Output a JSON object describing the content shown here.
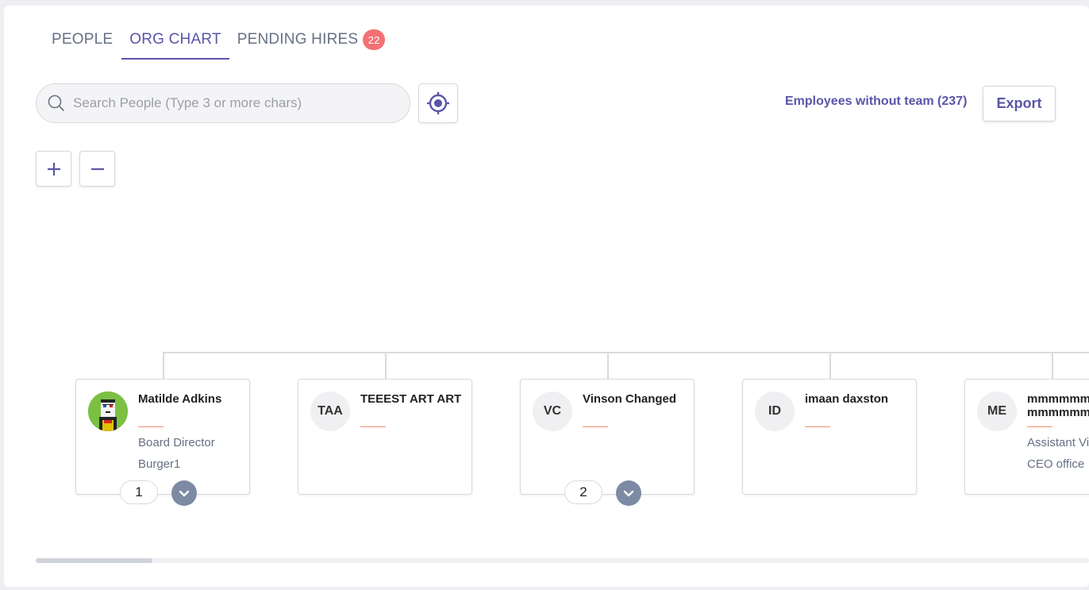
{
  "tabs": [
    {
      "label": "PEOPLE",
      "active": false
    },
    {
      "label": "ORG CHART",
      "active": true
    },
    {
      "label": "PENDING HIRES",
      "active": false,
      "badge": "22"
    }
  ],
  "search": {
    "placeholder": "Search People (Type 3 or more chars)",
    "value": ""
  },
  "toolbar": {
    "locate_icon": "target-icon",
    "no_team_link": "Employees without team (237)",
    "export_label": "Export",
    "zoom_in_icon": "plus-icon",
    "zoom_out_icon": "minus-icon"
  },
  "colors": {
    "accent": "#5b55a8",
    "badge": "#f47174",
    "divider": "#f09070",
    "expand": "#7d8aa3"
  },
  "cards": [
    {
      "initials": "",
      "photo": true,
      "name": "Matilde Adkins",
      "role": "Board Director",
      "team": "Burger1",
      "count": "1",
      "expandable": true
    },
    {
      "initials": "TAA",
      "photo": false,
      "name": "TEEEST ART ART",
      "role": "",
      "team": "",
      "count": "",
      "expandable": false
    },
    {
      "initials": "VC",
      "photo": false,
      "name": "Vinson Changed",
      "role": "",
      "team": "",
      "count": "2",
      "expandable": true
    },
    {
      "initials": "ID",
      "photo": false,
      "name": "imaan daxston",
      "role": "",
      "team": "",
      "count": "",
      "expandable": false
    },
    {
      "initials": "ME",
      "photo": false,
      "name": "mmmmmmmm mmmmmmmm",
      "role": "Assistant Vice President",
      "team": "CEO office",
      "count": "",
      "expandable": false
    }
  ]
}
